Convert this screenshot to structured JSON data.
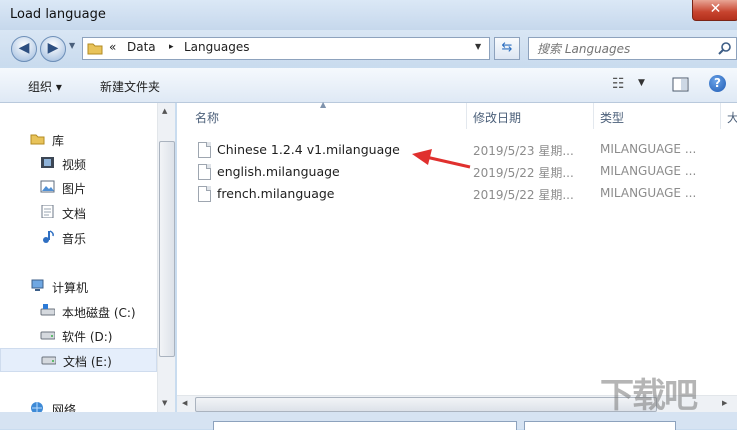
{
  "window": {
    "title": "Load language",
    "close_glyph": "✕"
  },
  "address_bar": {
    "prefix": "«",
    "breadcrumb": [
      "Data",
      "Languages"
    ],
    "separator": "▸"
  },
  "search": {
    "placeholder": "搜索 Languages"
  },
  "toolbar": {
    "organize_label": "组织 ▾",
    "new_folder_label": "新建文件夹"
  },
  "sidebar": {
    "groups": [
      {
        "label": "库",
        "icon": "library-folder-icon",
        "items": [
          {
            "label": "视频",
            "icon": "video-icon"
          },
          {
            "label": "图片",
            "icon": "picture-icon"
          },
          {
            "label": "文档",
            "icon": "document-icon"
          },
          {
            "label": "音乐",
            "icon": "music-icon"
          }
        ]
      },
      {
        "label": "计算机",
        "icon": "computer-icon",
        "items": [
          {
            "label": "本地磁盘 (C:)",
            "icon": "system-drive-icon"
          },
          {
            "label": "软件 (D:)",
            "icon": "drive-icon"
          },
          {
            "label": "文档 (E:)",
            "icon": "drive-icon",
            "selected": true
          }
        ]
      },
      {
        "label": "网络",
        "icon": "network-icon",
        "items": []
      }
    ]
  },
  "columns": [
    "名称",
    "修改日期",
    "类型",
    "大"
  ],
  "files": [
    {
      "name": "Chinese 1.2.4 v1.milanguage",
      "date": "2019/5/23 星期...",
      "type": "MILANGUAGE ..."
    },
    {
      "name": "english.milanguage",
      "date": "2019/5/22 星期...",
      "type": "MILANGUAGE ..."
    },
    {
      "name": "french.milanguage",
      "date": "2019/5/22 星期...",
      "type": "MILANGUAGE ..."
    }
  ],
  "watermark": "下载吧",
  "colors": {
    "annotation_arrow": "#e0302e",
    "selection": "#e5eefb",
    "close_button": "#c7432e"
  }
}
